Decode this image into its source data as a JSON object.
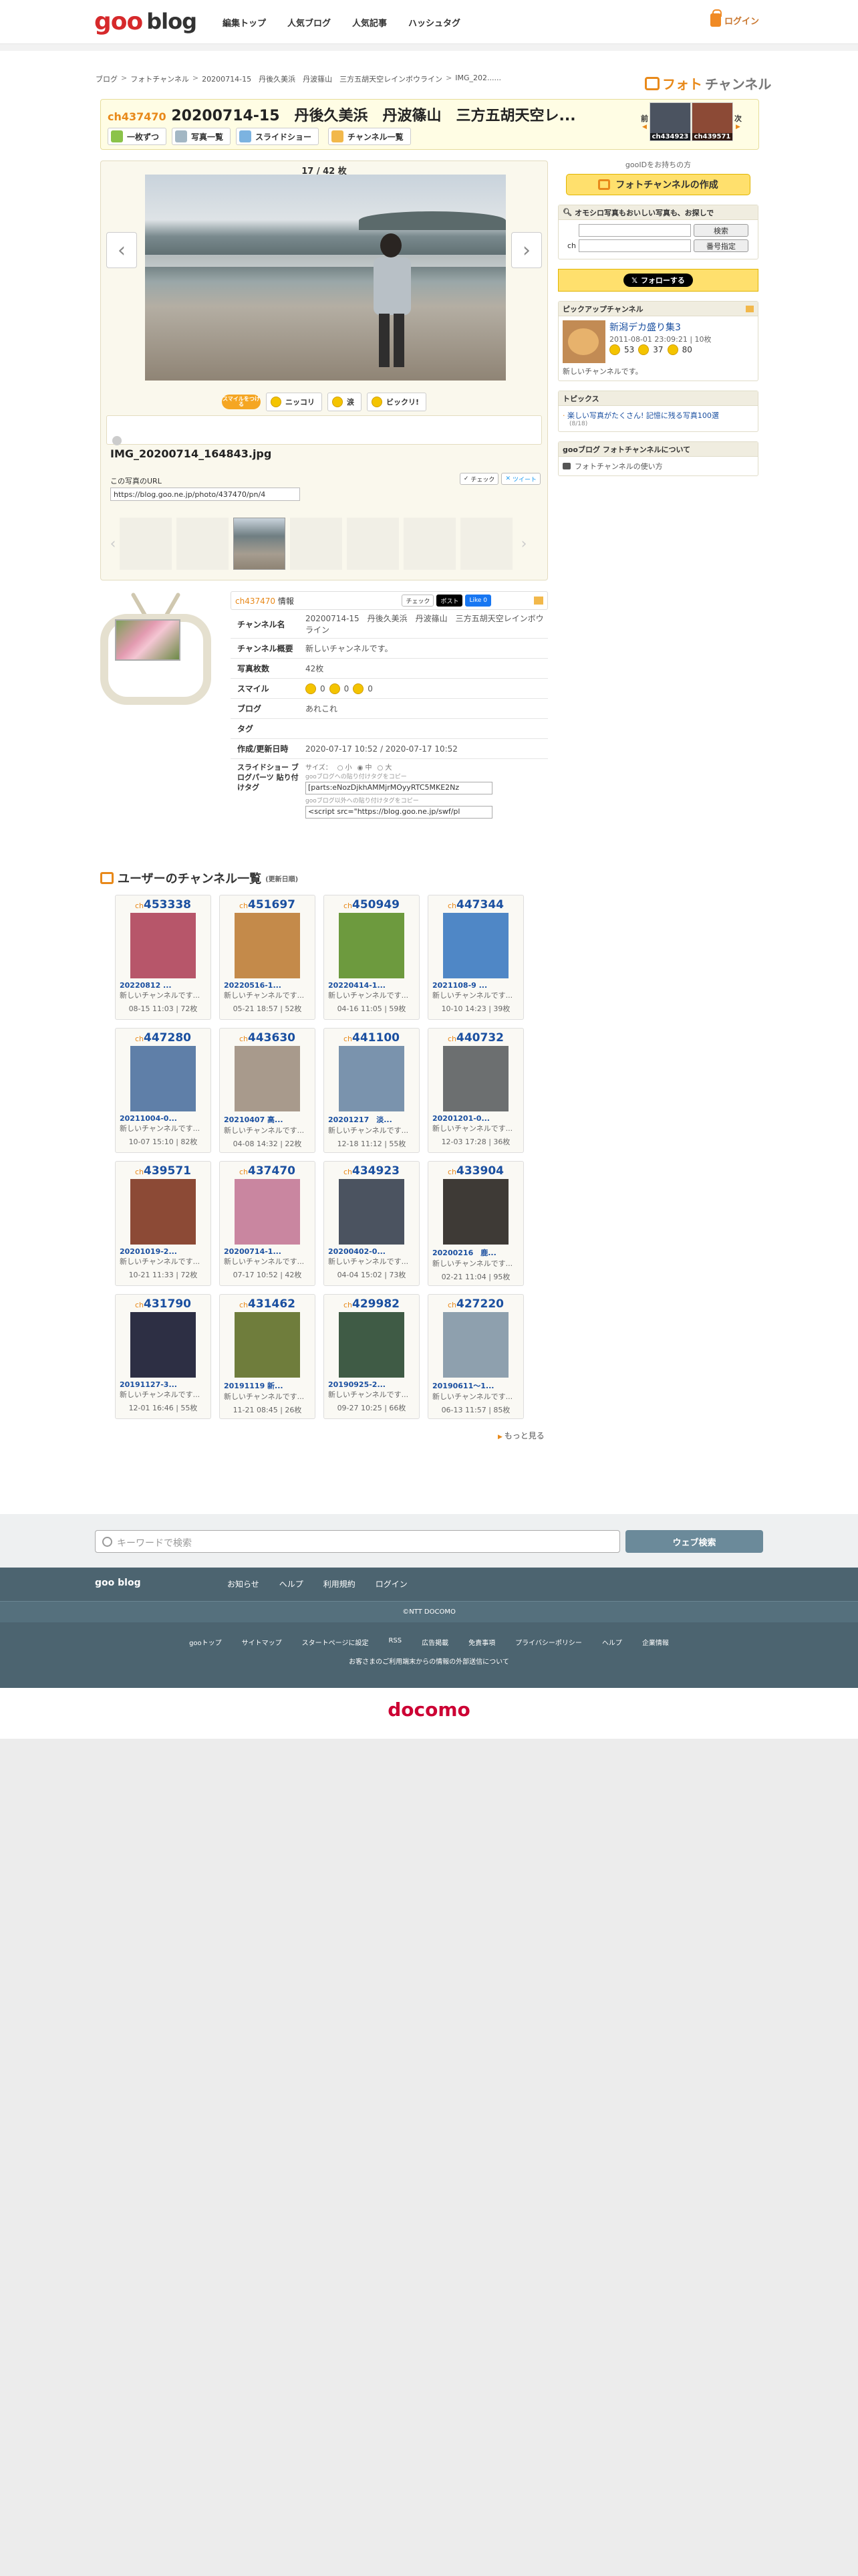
{
  "header": {
    "logo_goo": "goo",
    "logo_blog": "blog",
    "nav": [
      "編集トップ",
      "人気ブログ",
      "人気記事",
      "ハッシュタグ"
    ],
    "login": "ログイン"
  },
  "breadcrumb": [
    "ブログ",
    "フォトチャンネル",
    "20200714-15　丹後久美浜　丹波篠山　三方五胡天空レインボウライン",
    "IMG_202......"
  ],
  "brand": {
    "part1": "フォト",
    "part2": "チャンネル"
  },
  "channel": {
    "id_label": "ch437470",
    "title": "20200714-15　丹後久美浜　丹波篠山　三方五胡天空レ...",
    "tabs": [
      "一枚ずつ",
      "写真一覧",
      "スライドショー",
      "チャンネル一覧"
    ],
    "prev_label": "前",
    "next_label": "次",
    "prev_ch": "ch434923",
    "next_ch": "ch439571"
  },
  "viewer": {
    "counter": "17 / 42 枚",
    "smile_badge": "スマイルをつける",
    "reactions": [
      "ニッコリ",
      "涙",
      "ビックリ!"
    ],
    "filename": "IMG_20200714_164843.jpg",
    "url_label": "この写真のURL",
    "url_value": "https://blog.goo.ne.jp/photo/437470/pn/4",
    "share_check": "チェック",
    "share_tweet": "ツイート"
  },
  "sidebar": {
    "id_hint": "gooIDをお持ちの方",
    "create_btn": "フォトチャンネルの作成",
    "search_head": "オモシロ写真もおいしい写真も、お探しで",
    "search_btn": "検索",
    "ch_label": "ch",
    "number_btn": "番号指定",
    "follow": "フォローする",
    "pickup_head": "ピックアップチャンネル",
    "pickup_title": "新潟デカ盛り集3",
    "pickup_meta": "2011-08-01 23:09:21 | 10枚",
    "pickup_s1": "53",
    "pickup_s2": "37",
    "pickup_s3": "80",
    "pickup_desc": "新しいチャンネルです。",
    "topics_head": "トピックス",
    "topics_item": "楽しい写真がたくさん! 記憶に残る写真100選",
    "topics_sub": "(8/18)",
    "about_head": "gooブログ フォトチャンネルについて",
    "about_item": "フォトチャンネルの使い方"
  },
  "info": {
    "ch": "ch437470",
    "head": "情報",
    "check": "チェック",
    "post": "ポスト",
    "like": "Like 0",
    "rows": {
      "name_k": "チャンネル名",
      "name_v": "20200714-15　丹後久美浜　丹波篠山　三方五胡天空レインボウライン",
      "desc_k": "チャンネル概要",
      "desc_v": "新しいチャンネルです。",
      "count_k": "写真枚数",
      "count_v": "42枚",
      "smile_k": "スマイル",
      "smile_1": "0",
      "smile_2": "0",
      "smile_3": "0",
      "blog_k": "ブログ",
      "blog_v": "あれこれ",
      "tag_k": "タグ",
      "tag_v": "",
      "date_k": "作成/更新日時",
      "date_v": "2020-07-17 10:52 / 2020-07-17 10:52",
      "slide_k": "スライドショー ブログパーツ 貼り付けタグ",
      "size_label": "サイズ：",
      "size_s": "小",
      "size_m": "中",
      "size_l": "大",
      "copy1": "gooブログへの貼り付けタグをコピー",
      "tag1": "[parts:eNozDjkhAMMjrMOyyRTC5MKE2Nz",
      "copy2": "gooブログ以外への貼り付けタグをコピー",
      "tag2": "<script src=\"https://blog.goo.ne.jp/swf/pl"
    }
  },
  "list": {
    "title": "ユーザーのチャンネル一覧",
    "sub": "(更新日順)",
    "more": "もっと見る",
    "cards": [
      {
        "id": "453338",
        "name": "20220812 ...",
        "desc": "新しいチャンネルです...",
        "meta": "08-15 11:03 | 72枚",
        "color": "#b7566a"
      },
      {
        "id": "451697",
        "name": "20220516-1...",
        "desc": "新しいチャンネルです...",
        "meta": "05-21 18:57 | 52枚",
        "color": "#c48a4a"
      },
      {
        "id": "450949",
        "name": "20220414-1...",
        "desc": "新しいチャンネルです...",
        "meta": "04-16 11:05 | 59枚",
        "color": "#6d9a3e"
      },
      {
        "id": "447344",
        "name": "2021108-9 ...",
        "desc": "新しいチャンネルです...",
        "meta": "10-10 14:23 | 39枚",
        "color": "#4f87c6"
      },
      {
        "id": "447280",
        "name": "20211004-0...",
        "desc": "新しいチャンネルです...",
        "meta": "10-07 15:10 | 82枚",
        "color": "#5f7fa8"
      },
      {
        "id": "443630",
        "name": "20210407 高...",
        "desc": "新しいチャンネルです...",
        "meta": "04-08 14:32 | 22枚",
        "color": "#a89a8c"
      },
      {
        "id": "441100",
        "name": "20201217　淡...",
        "desc": "新しいチャンネルです...",
        "meta": "12-18 11:12 | 55枚",
        "color": "#7a93ad"
      },
      {
        "id": "440732",
        "name": "20201201-0...",
        "desc": "新しいチャンネルです...",
        "meta": "12-03 17:28 | 36枚",
        "color": "#6c6f70"
      },
      {
        "id": "439571",
        "name": "20201019-2...",
        "desc": "新しいチャンネルです...",
        "meta": "10-21 11:33 | 72枚",
        "color": "#8c4a36"
      },
      {
        "id": "437470",
        "name": "20200714-1...",
        "desc": "新しいチャンネルです...",
        "meta": "07-17 10:52 | 42枚",
        "color": "#c986a0"
      },
      {
        "id": "434923",
        "name": "20200402-0...",
        "desc": "新しいチャンネルです...",
        "meta": "04-04 15:02 | 73枚",
        "color": "#4b5360"
      },
      {
        "id": "433904",
        "name": "20200216　鹿...",
        "desc": "新しいチャンネルです...",
        "meta": "02-21 11:04 | 95枚",
        "color": "#3e3a36"
      },
      {
        "id": "431790",
        "name": "20191127-3...",
        "desc": "新しいチャンネルです...",
        "meta": "12-01 16:46 | 55枚",
        "color": "#2d2f44"
      },
      {
        "id": "431462",
        "name": "20191119 新...",
        "desc": "新しいチャンネルです...",
        "meta": "11-21 08:45 | 26枚",
        "color": "#6f7d3c"
      },
      {
        "id": "429982",
        "name": "20190925-2...",
        "desc": "新しいチャンネルです...",
        "meta": "09-27 10:25 | 66枚",
        "color": "#3f5b45"
      },
      {
        "id": "427220",
        "name": "20190611〜1...",
        "desc": "新しいチャンネルです...",
        "meta": "06-13 11:57 | 85枚",
        "color": "#8ea0ae"
      }
    ]
  },
  "footer": {
    "search_placeholder": "キーワードで検索",
    "search_btn": "ウェブ検索",
    "logo": "goo blog",
    "links": [
      "お知らせ",
      "ヘルプ",
      "利用規約",
      "ログイン"
    ],
    "copyright": "©NTT DOCOMO",
    "links2": [
      "gooトップ",
      "サイトマップ",
      "スタートページに設定",
      "RSS",
      "広告掲載",
      "免責事項",
      "プライバシーポリシー",
      "ヘルプ",
      "企業情報"
    ],
    "notice": "お客さまのご利用端末からの情報の外部送信について",
    "docomo": "docomo"
  }
}
